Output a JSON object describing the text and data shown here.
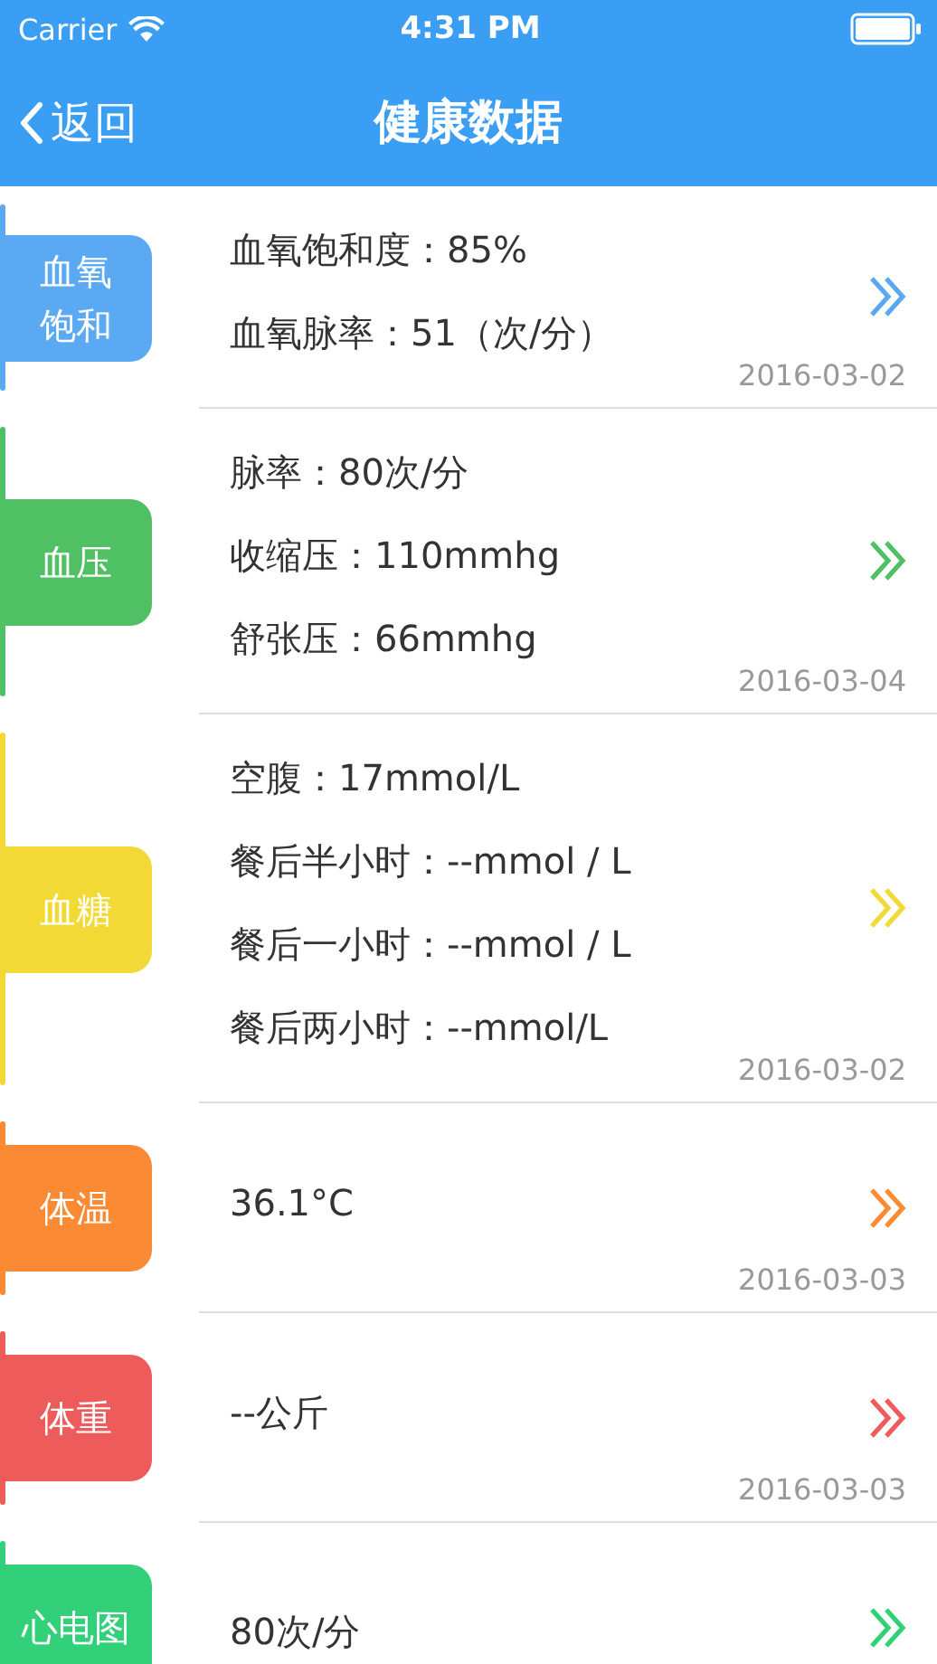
{
  "status_bar": {
    "carrier": "Carrier",
    "time": "4:31 PM"
  },
  "nav": {
    "back": "返回",
    "title": "健康数据"
  },
  "records": [
    {
      "tag_lines": [
        "血氧",
        "饱和"
      ],
      "color": "#5aa9f2",
      "lines": [
        "血氧饱和度：85%",
        "血氧脉率：51（次/分）"
      ],
      "date": "2016-03-02"
    },
    {
      "tag_lines": [
        "血压"
      ],
      "color": "#4fc064",
      "lines": [
        "脉率：80次/分",
        "收缩压：110mmhg",
        "舒张压：66mmhg"
      ],
      "date": "2016-03-04"
    },
    {
      "tag_lines": [
        "血糖"
      ],
      "color": "#f2d936",
      "lines": [
        "空腹：17mmol/L",
        "餐后半小时：--mmol / L",
        "餐后一小时：--mmol / L",
        "餐后两小时：--mmol/L"
      ],
      "date": "2016-03-02"
    },
    {
      "tag_lines": [
        "体温"
      ],
      "color": "#fb8a35",
      "lines": [
        "36.1°C"
      ],
      "date": "2016-03-03"
    },
    {
      "tag_lines": [
        "体重"
      ],
      "color": "#ee5b5b",
      "lines": [
        "--公斤"
      ],
      "date": "2016-03-03"
    },
    {
      "tag_lines": [
        "心电图"
      ],
      "color": "#33d07a",
      "lines": [
        "80次/分"
      ]
    }
  ]
}
